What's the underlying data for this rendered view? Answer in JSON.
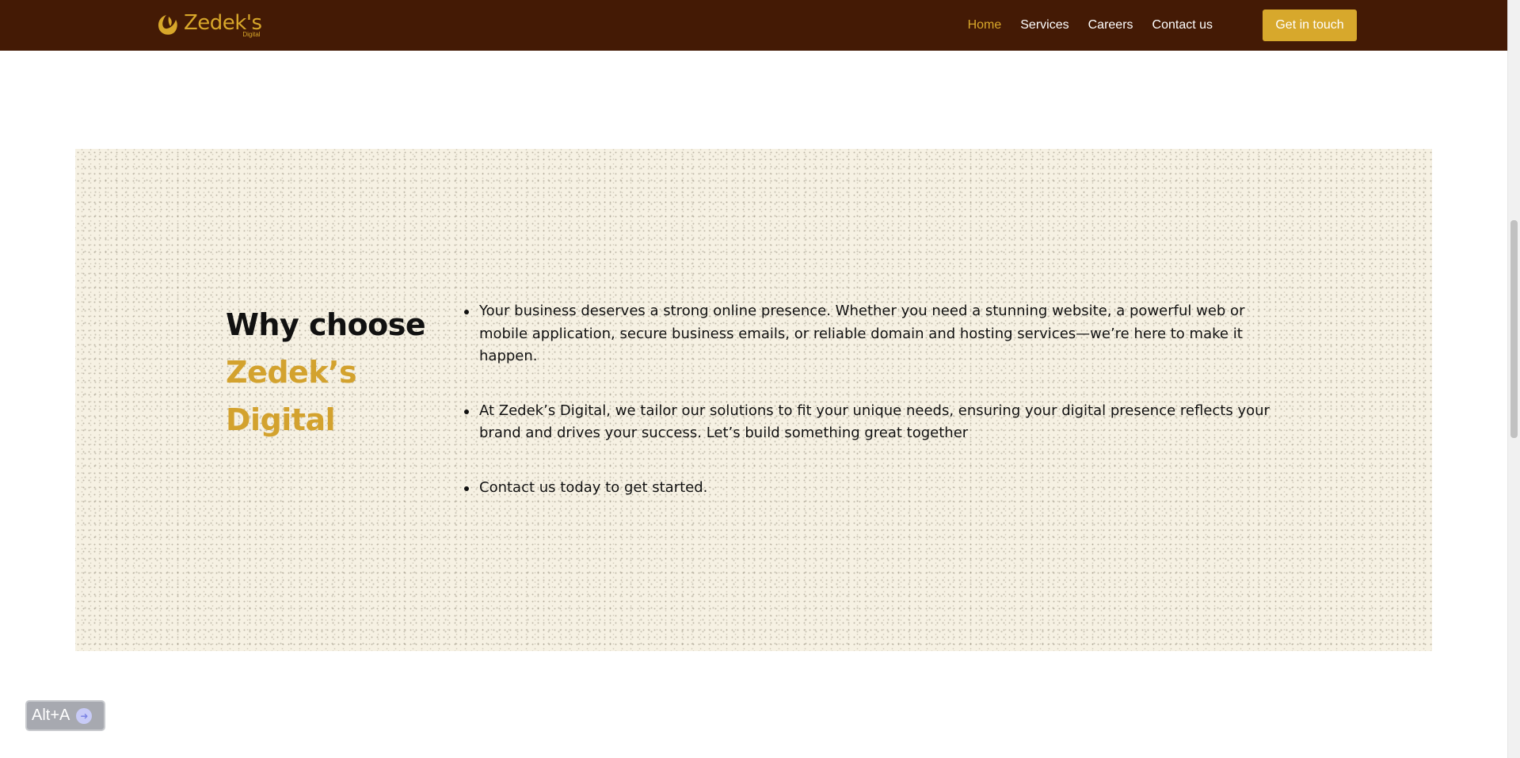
{
  "header": {
    "logo_text": "Zedek's",
    "logo_subtext": "Digital",
    "nav": [
      {
        "label": "Home",
        "active": true
      },
      {
        "label": "Services",
        "active": false
      },
      {
        "label": "Careers",
        "active": false
      },
      {
        "label": "Contact us",
        "active": false
      }
    ],
    "cta_label": "Get in touch"
  },
  "why": {
    "heading_line1": "Why choose",
    "heading_line2": "Zedek’s Digital",
    "points": [
      "Your business deserves a strong online presence. Whether you need a stunning website, a powerful web or mobile application, secure business emails, or reliable domain and hosting services—we’re here to make it happen.",
      "At Zedek’s Digital, we tailor our solutions to fit your unique needs, ensuring your digital presence reflects your brand and drives your success. Let’s build something great together",
      "Contact us today to get started."
    ]
  },
  "accessibility_widget": {
    "label": "Alt+A",
    "icon": "arrow-right-icon"
  },
  "colors": {
    "header_bg": "#441a05",
    "accent": "#d7a82c",
    "band_bg": "#f6f1e3",
    "text": "#111111"
  }
}
